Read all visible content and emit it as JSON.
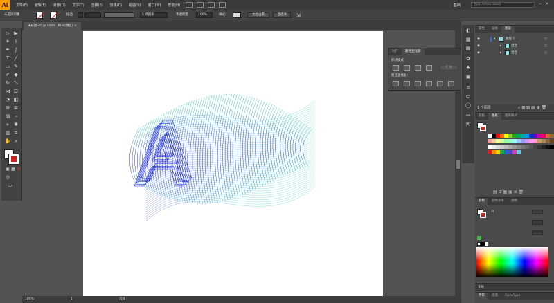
{
  "app": {
    "logo": "Ai"
  },
  "menubar": {
    "items": [
      "文件(F)",
      "编辑(E)",
      "对象(O)",
      "文字(T)",
      "选择(S)",
      "效果(C)",
      "视图(V)",
      "窗口(W)",
      "帮助(H)"
    ],
    "workspace": "基础",
    "search_placeholder": "搜索 Adobe Stock"
  },
  "controlbar": {
    "selection_label": "未选择对象",
    "stroke_label": "描边:",
    "brush_label": "5 点圆形",
    "opacity_label": "不透明度",
    "opacity_value": "100%",
    "style_label": "样式:",
    "doc_setup": "文档设置",
    "prefs": "首选项"
  },
  "document": {
    "tab_title": "未标题-4* @ 100% (RGB/预览)"
  },
  "status": {
    "zoom": "100%",
    "artboard": "1",
    "tool": "选择"
  },
  "pathfinder": {
    "tabs": [
      "对齐",
      "路径查找器"
    ],
    "shape_modes_label": "形状模式:",
    "expand_button": "扩展",
    "pathfinders_label": "路径查找器:"
  },
  "layers": {
    "tabs": [
      "属性",
      "画板",
      "图层"
    ],
    "rows": [
      {
        "name": "图层 1",
        "indent": 0
      },
      {
        "name": "混合",
        "indent": 1
      },
      {
        "name": "混合",
        "indent": 1
      }
    ],
    "footer_count": "1 个图层"
  },
  "swatches": {
    "tabs": [
      "颜色",
      "色板",
      "图形样式"
    ]
  },
  "color": {
    "tabs": [
      "颜色",
      "颜色参考",
      "透明"
    ],
    "channel_label": "R"
  },
  "bottom": {
    "transform_tab": "变换",
    "tabs": [
      "字符",
      "段落",
      "OpenType"
    ]
  },
  "colors": {
    "accent_orange": "#ff9a00",
    "blend_start": "#1e2cd6",
    "blend_end": "#21d6a0"
  }
}
